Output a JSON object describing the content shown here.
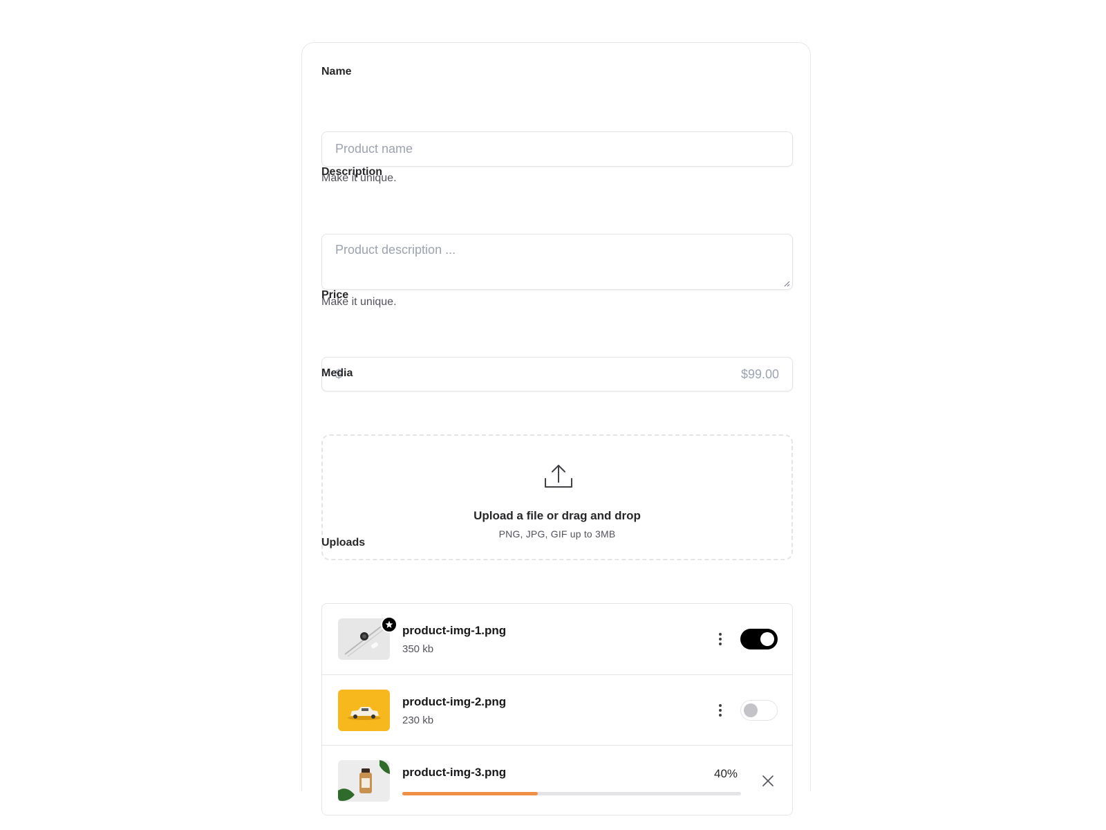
{
  "form": {
    "name": {
      "label": "Name",
      "placeholder": "Product name",
      "value": "",
      "help": "Make it unique."
    },
    "description": {
      "label": "Description",
      "placeholder": "Product description ...",
      "value": "",
      "help": "Make it unique."
    },
    "price": {
      "label": "Price",
      "prefix": "$",
      "placeholder": "$99.00",
      "value": ""
    },
    "media": {
      "label": "Media",
      "icon": "upload-icon",
      "title": "Upload a file or drag and drop",
      "subtitle": "PNG, JPG, GIF up to 3MB"
    },
    "uploads": {
      "label": "Uploads",
      "files": [
        {
          "name": "product-img-1.png",
          "size": "350 kb",
          "featured": true,
          "enabled": true
        },
        {
          "name": "product-img-2.png",
          "size": "230 kb",
          "featured": false,
          "enabled": false
        },
        {
          "name": "product-img-3.png",
          "progress_label": "40%",
          "progress": 0.4
        }
      ]
    }
  },
  "colors": {
    "progress_fill": "#ef8f45",
    "toggle_on": "#000000",
    "thumb_2_bg": "#f6b81c"
  }
}
